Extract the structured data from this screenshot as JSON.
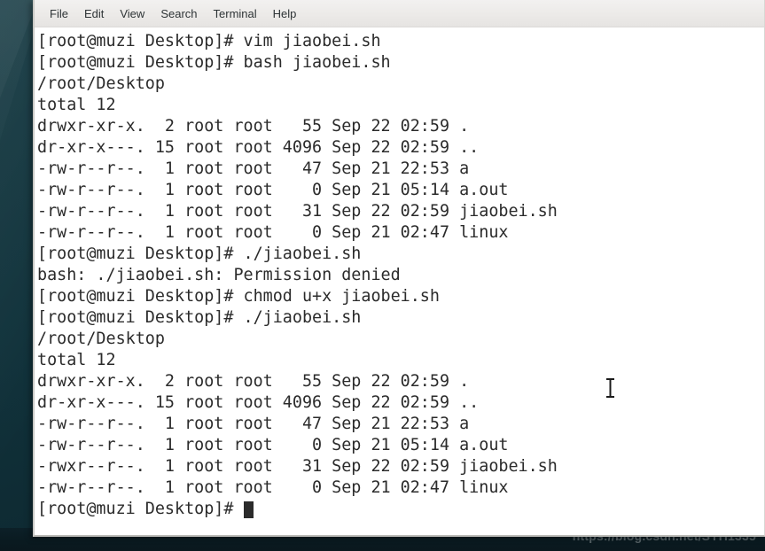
{
  "desktop": {
    "background_color": "#123740",
    "watermark": "https://blog.csdn.net/SYH1335"
  },
  "window": {
    "title": "Terminal",
    "background_color": "#ffffff",
    "text_color": "#2b2b2b"
  },
  "menubar": {
    "items": [
      {
        "label": "File"
      },
      {
        "label": "Edit"
      },
      {
        "label": "View"
      },
      {
        "label": "Search"
      },
      {
        "label": "Terminal"
      },
      {
        "label": "Help"
      }
    ]
  },
  "terminal": {
    "prompt": "[root@muzi Desktop]#",
    "cursor": "block",
    "lines": [
      {
        "kind": "command",
        "text": "[root@muzi Desktop]# vim jiaobei.sh"
      },
      {
        "kind": "command",
        "text": "[root@muzi Desktop]# bash jiaobei.sh"
      },
      {
        "kind": "output",
        "text": "/root/Desktop"
      },
      {
        "kind": "output",
        "text": "total 12"
      },
      {
        "kind": "output",
        "text": "drwxr-xr-x.  2 root root   55 Sep 22 02:59 ."
      },
      {
        "kind": "output",
        "text": "dr-xr-x---. 15 root root 4096 Sep 22 02:59 .."
      },
      {
        "kind": "output",
        "text": "-rw-r--r--.  1 root root   47 Sep 21 22:53 a"
      },
      {
        "kind": "output",
        "text": "-rw-r--r--.  1 root root    0 Sep 21 05:14 a.out"
      },
      {
        "kind": "output",
        "text": "-rw-r--r--.  1 root root   31 Sep 22 02:59 jiaobei.sh"
      },
      {
        "kind": "output",
        "text": "-rw-r--r--.  1 root root    0 Sep 21 02:47 linux"
      },
      {
        "kind": "command",
        "text": "[root@muzi Desktop]# ./jiaobei.sh"
      },
      {
        "kind": "error",
        "text": "bash: ./jiaobei.sh: Permission denied"
      },
      {
        "kind": "command",
        "text": "[root@muzi Desktop]# chmod u+x jiaobei.sh"
      },
      {
        "kind": "command",
        "text": "[root@muzi Desktop]# ./jiaobei.sh"
      },
      {
        "kind": "output",
        "text": "/root/Desktop"
      },
      {
        "kind": "output",
        "text": "total 12"
      },
      {
        "kind": "output",
        "text": "drwxr-xr-x.  2 root root   55 Sep 22 02:59 ."
      },
      {
        "kind": "output",
        "text": "dr-xr-x---. 15 root root 4096 Sep 22 02:59 .."
      },
      {
        "kind": "output",
        "text": "-rw-r--r--.  1 root root   47 Sep 21 22:53 a"
      },
      {
        "kind": "output",
        "text": "-rw-r--r--.  1 root root    0 Sep 21 05:14 a.out"
      },
      {
        "kind": "output",
        "text": "-rwxr--r--.  1 root root   31 Sep 22 02:59 jiaobei.sh"
      },
      {
        "kind": "output",
        "text": "-rw-r--r--.  1 root root    0 Sep 21 02:47 linux"
      }
    ],
    "final_prompt": "[root@muzi Desktop]# "
  }
}
